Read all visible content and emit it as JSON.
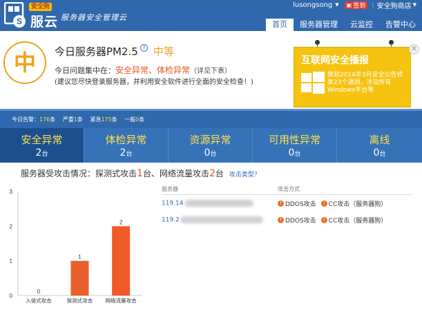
{
  "header": {
    "logo_badge": "安全狗",
    "logo_text": "服云",
    "slogan": "服务器安全管理云",
    "user": {
      "name": "lusongsong",
      "signin": "签到",
      "shop": "安全狗商店"
    },
    "nav": [
      {
        "label": "首页",
        "active": true
      },
      {
        "label": "服务器管理",
        "active": false
      },
      {
        "label": "云监控",
        "active": false
      },
      {
        "label": "告警中心",
        "active": false
      }
    ]
  },
  "summary": {
    "grade_char": "中",
    "title": "今日服务器PM2.5",
    "help": "?",
    "grade_text": "中等",
    "problem_prefix": "今日问题集中在：",
    "problem_items": "安全异常、体检异常",
    "problem_suffix": "（详见下表）",
    "advice": "(建议您尽快登录服务器，并利用安全软件进行全面的安全检查！)"
  },
  "broadcast": {
    "title": "互联网安全播报",
    "text": "微软2014年3月安全公告修复23个漏洞，涉及所有Windows平台等"
  },
  "alerts": {
    "today_label": "今日告警：",
    "today_count": "176",
    "unit": "条",
    "severe_label": "严重",
    "severe_count": "1",
    "urgent_label": "紧急",
    "urgent_count": "175",
    "normal_label": "一般",
    "normal_count": "0"
  },
  "categories": [
    {
      "label": "安全异常",
      "count": "2",
      "unit": "台",
      "active": true
    },
    {
      "label": "体检异常",
      "count": "2",
      "unit": "台",
      "active": false
    },
    {
      "label": "资源异常",
      "count": "0",
      "unit": "台",
      "active": false
    },
    {
      "label": "可用性异常",
      "count": "0",
      "unit": "台",
      "active": false
    },
    {
      "label": "离线",
      "count": "0",
      "unit": "台",
      "active": false
    }
  ],
  "attack": {
    "prefix": "服务器受攻击情况：探测式攻击",
    "probe_count": "1",
    "mid": "台、网络流量攻击",
    "flood_count": "2",
    "suffix": "台",
    "link": "攻击类型？"
  },
  "chart_data": {
    "type": "bar",
    "categories": [
      "入侵式攻击",
      "探测式攻击",
      "网络流量攻击"
    ],
    "values": [
      0,
      1,
      2
    ],
    "ylim": [
      0,
      3
    ],
    "yticks": [
      0,
      1,
      2,
      3
    ],
    "colors": [
      "#e8602c",
      "#e8602c",
      "#f05a28"
    ]
  },
  "table": {
    "headers": {
      "server": "服务器",
      "attack": "攻击方式"
    },
    "rows": [
      {
        "server": "119.14",
        "attacks": [
          "DDOS攻击",
          "CC攻击（服务器狗）"
        ]
      },
      {
        "server": "119.2",
        "attacks": [
          "DDOS攻击",
          "CC攻击（服务器狗）"
        ]
      }
    ]
  },
  "colors": {
    "primary": "#2f68ad",
    "accent_orange": "#f0a020",
    "highlight": "#e8531e",
    "yellow": "#ffe14a",
    "broadcast": "#f5c310"
  }
}
